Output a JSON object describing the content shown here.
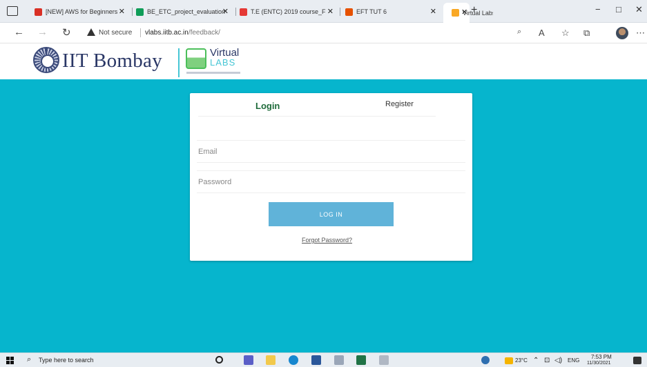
{
  "browser": {
    "tabs": [
      {
        "label": "[NEW] AWS for Beginners",
        "color": "#d93025"
      },
      {
        "label": "BE_ETC_project_evaluation",
        "color": "#0f9d58"
      },
      {
        "label": "T.E (ENTC) 2019 course_F",
        "color": "#e53935"
      },
      {
        "label": "EFT TUT 6",
        "color": "#e65100"
      },
      {
        "label": "Virtual Labs",
        "color": "#f9a825"
      }
    ],
    "new_tab": "+",
    "minimize": "−",
    "maximize": "□",
    "close": "✕",
    "address": {
      "security_label": "Not secure",
      "domain": "vlabs.iitb.ac.in",
      "path": "/feedback/"
    }
  },
  "site": {
    "brand": "IIT Bombay",
    "vl_line1": "Virtual",
    "vl_line2": "LABS"
  },
  "login_card": {
    "tab_login": "Login",
    "tab_register": "Register",
    "email_placeholder": "Email",
    "password_placeholder": "Password",
    "login_button": "LOG IN",
    "forgot_link": "Forgot Password?"
  },
  "taskbar": {
    "search_placeholder": "Type here to search",
    "temperature": "23°C",
    "language": "ENG",
    "time": "7:53 PM",
    "date": "11/30/2021"
  },
  "colors": {
    "main_background": "#06b5cd",
    "login_button": "#60b3d9",
    "login_tab_text": "#1e6b3a"
  }
}
